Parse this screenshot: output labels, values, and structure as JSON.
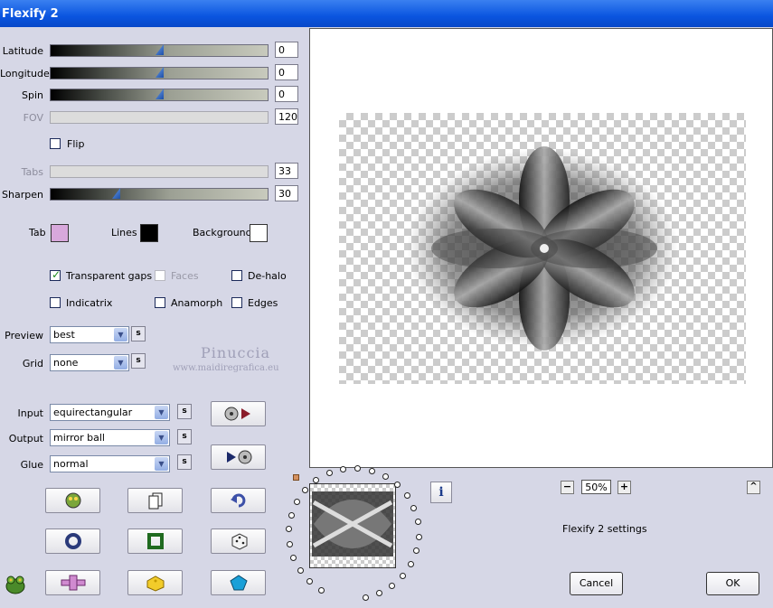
{
  "window": {
    "title": "Flexify 2"
  },
  "sliders": [
    {
      "label": "Latitude",
      "value": "0",
      "level": 0.5,
      "enabled": true
    },
    {
      "label": "Longitude",
      "value": "0",
      "level": 0.5,
      "enabled": true
    },
    {
      "label": "Spin",
      "value": "0",
      "level": 0.5,
      "enabled": true
    },
    {
      "label": "FOV",
      "value": "120",
      "enabled": false
    },
    {
      "label": "Tabs",
      "value": "33",
      "enabled": false
    },
    {
      "label": "Sharpen",
      "value": "30",
      "level": 0.3,
      "enabled": true
    }
  ],
  "flip": {
    "label": "Flip",
    "checked": false
  },
  "colors": {
    "tab": {
      "label": "Tab",
      "color": "#d8a8dc"
    },
    "lines": {
      "label": "Lines",
      "color": "#000000"
    },
    "background": {
      "label": "Background",
      "color": "#ffffff"
    }
  },
  "options": {
    "transparent_gaps": {
      "label": "Transparent gaps",
      "checked": true
    },
    "faces": {
      "label": "Faces",
      "checked": false,
      "enabled": false
    },
    "de_halo": {
      "label": "De-halo",
      "checked": false
    },
    "indicatrix": {
      "label": "Indicatrix",
      "checked": false
    },
    "anamorph": {
      "label": "Anamorph",
      "checked": false
    },
    "edges": {
      "label": "Edges",
      "checked": false
    }
  },
  "preview_select": {
    "label": "Preview",
    "value": "best"
  },
  "grid_select": {
    "label": "Grid",
    "value": "none"
  },
  "input_select": {
    "label": "Input",
    "value": "equirectangular"
  },
  "output_select": {
    "label": "Output",
    "value": "mirror ball"
  },
  "glue_select": {
    "label": "Glue",
    "value": "normal"
  },
  "s_button": "s",
  "watermark": {
    "line1": "Pinuccia",
    "line2": "www.maidiregrafica.eu"
  },
  "zoom": {
    "minus": "−",
    "value": "50%",
    "plus": "+"
  },
  "settings_name": "Flexify 2 settings",
  "buttons": {
    "cancel": "Cancel",
    "ok": "OK",
    "info": "i",
    "collapse": "^"
  },
  "icons": {
    "swap_1": "film-reel-arrow-icon",
    "swap_2": "arrow-film-reel-icon",
    "row1": [
      "frog-icon",
      "copy-icon",
      "undo-icon"
    ],
    "row2": [
      "ring-icon",
      "square-frame-icon",
      "dice-icon"
    ],
    "row3": [
      "plus-shape-icon",
      "cheese-icon",
      "pentagon-icon"
    ]
  },
  "accent": "#0a55e0"
}
